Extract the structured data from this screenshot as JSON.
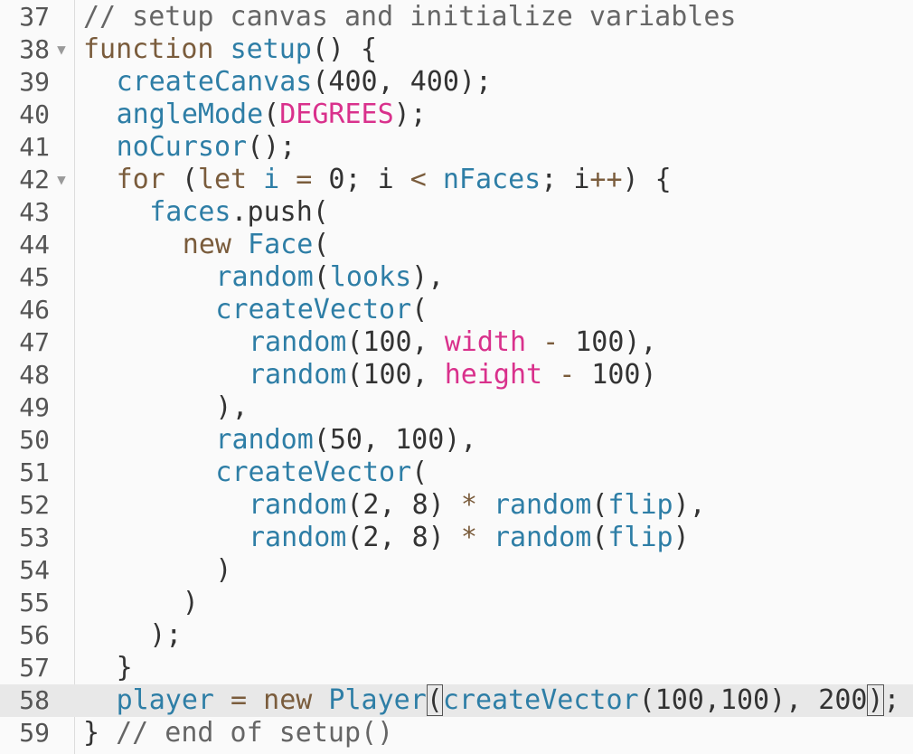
{
  "editor": {
    "lines": [
      {
        "n": "37",
        "fold": "",
        "indent": 0,
        "tokens": [
          {
            "t": "// setup canvas and initialize variables",
            "c": "comment"
          }
        ]
      },
      {
        "n": "38",
        "fold": "▼",
        "indent": 0,
        "tokens": [
          {
            "t": "function",
            "c": "keyword"
          },
          {
            "t": " ",
            "c": "plain"
          },
          {
            "t": "setup",
            "c": "func"
          },
          {
            "t": "() {",
            "c": "plain"
          }
        ]
      },
      {
        "n": "39",
        "fold": "",
        "indent": 1,
        "tokens": [
          {
            "t": "createCanvas",
            "c": "func"
          },
          {
            "t": "(400, 400);",
            "c": "plain"
          }
        ]
      },
      {
        "n": "40",
        "fold": "",
        "indent": 1,
        "tokens": [
          {
            "t": "angleMode",
            "c": "func"
          },
          {
            "t": "(",
            "c": "plain"
          },
          {
            "t": "DEGREES",
            "c": "constant"
          },
          {
            "t": ");",
            "c": "plain"
          }
        ]
      },
      {
        "n": "41",
        "fold": "",
        "indent": 1,
        "tokens": [
          {
            "t": "noCursor",
            "c": "func"
          },
          {
            "t": "();",
            "c": "plain"
          }
        ]
      },
      {
        "n": "42",
        "fold": "▼",
        "indent": 1,
        "tokens": [
          {
            "t": "for",
            "c": "keyword"
          },
          {
            "t": " (",
            "c": "plain"
          },
          {
            "t": "let",
            "c": "keyword"
          },
          {
            "t": " ",
            "c": "plain"
          },
          {
            "t": "i",
            "c": "var"
          },
          {
            "t": " ",
            "c": "plain"
          },
          {
            "t": "=",
            "c": "operator"
          },
          {
            "t": " 0; i ",
            "c": "plain"
          },
          {
            "t": "<",
            "c": "operator"
          },
          {
            "t": " ",
            "c": "plain"
          },
          {
            "t": "nFaces",
            "c": "var"
          },
          {
            "t": "; i",
            "c": "plain"
          },
          {
            "t": "++",
            "c": "operator"
          },
          {
            "t": ") {",
            "c": "plain"
          }
        ]
      },
      {
        "n": "43",
        "fold": "",
        "indent": 2,
        "tokens": [
          {
            "t": "faces",
            "c": "var"
          },
          {
            "t": ".push(",
            "c": "plain"
          }
        ]
      },
      {
        "n": "44",
        "fold": "",
        "indent": 3,
        "tokens": [
          {
            "t": "new",
            "c": "keyword"
          },
          {
            "t": " ",
            "c": "plain"
          },
          {
            "t": "Face",
            "c": "var"
          },
          {
            "t": "(",
            "c": "plain"
          }
        ]
      },
      {
        "n": "45",
        "fold": "",
        "indent": 4,
        "tokens": [
          {
            "t": "random",
            "c": "func"
          },
          {
            "t": "(",
            "c": "plain"
          },
          {
            "t": "looks",
            "c": "var"
          },
          {
            "t": "),",
            "c": "plain"
          }
        ]
      },
      {
        "n": "46",
        "fold": "",
        "indent": 4,
        "tokens": [
          {
            "t": "createVector",
            "c": "func"
          },
          {
            "t": "(",
            "c": "plain"
          }
        ]
      },
      {
        "n": "47",
        "fold": "",
        "indent": 5,
        "tokens": [
          {
            "t": "random",
            "c": "func"
          },
          {
            "t": "(100, ",
            "c": "plain"
          },
          {
            "t": "width",
            "c": "constant"
          },
          {
            "t": " ",
            "c": "plain"
          },
          {
            "t": "-",
            "c": "operator"
          },
          {
            "t": " 100),",
            "c": "plain"
          }
        ]
      },
      {
        "n": "48",
        "fold": "",
        "indent": 5,
        "tokens": [
          {
            "t": "random",
            "c": "func"
          },
          {
            "t": "(100, ",
            "c": "plain"
          },
          {
            "t": "height",
            "c": "constant"
          },
          {
            "t": " ",
            "c": "plain"
          },
          {
            "t": "-",
            "c": "operator"
          },
          {
            "t": " 100)",
            "c": "plain"
          }
        ]
      },
      {
        "n": "49",
        "fold": "",
        "indent": 4,
        "tokens": [
          {
            "t": "),",
            "c": "plain"
          }
        ]
      },
      {
        "n": "50",
        "fold": "",
        "indent": 4,
        "tokens": [
          {
            "t": "random",
            "c": "func"
          },
          {
            "t": "(50, 100),",
            "c": "plain"
          }
        ]
      },
      {
        "n": "51",
        "fold": "",
        "indent": 4,
        "tokens": [
          {
            "t": "createVector",
            "c": "func"
          },
          {
            "t": "(",
            "c": "plain"
          }
        ]
      },
      {
        "n": "52",
        "fold": "",
        "indent": 5,
        "tokens": [
          {
            "t": "random",
            "c": "func"
          },
          {
            "t": "(2, 8) ",
            "c": "plain"
          },
          {
            "t": "*",
            "c": "operator"
          },
          {
            "t": " ",
            "c": "plain"
          },
          {
            "t": "random",
            "c": "func"
          },
          {
            "t": "(",
            "c": "plain"
          },
          {
            "t": "flip",
            "c": "var"
          },
          {
            "t": "),",
            "c": "plain"
          }
        ]
      },
      {
        "n": "53",
        "fold": "",
        "indent": 5,
        "tokens": [
          {
            "t": "random",
            "c": "func"
          },
          {
            "t": "(2, 8) ",
            "c": "plain"
          },
          {
            "t": "*",
            "c": "operator"
          },
          {
            "t": " ",
            "c": "plain"
          },
          {
            "t": "random",
            "c": "func"
          },
          {
            "t": "(",
            "c": "plain"
          },
          {
            "t": "flip",
            "c": "var"
          },
          {
            "t": ")",
            "c": "plain"
          }
        ]
      },
      {
        "n": "54",
        "fold": "",
        "indent": 4,
        "tokens": [
          {
            "t": ")",
            "c": "plain"
          }
        ]
      },
      {
        "n": "55",
        "fold": "",
        "indent": 3,
        "tokens": [
          {
            "t": ")",
            "c": "plain"
          }
        ]
      },
      {
        "n": "56",
        "fold": "",
        "indent": 2,
        "tokens": [
          {
            "t": ");",
            "c": "plain"
          }
        ]
      },
      {
        "n": "57",
        "fold": "",
        "indent": 1,
        "tokens": [
          {
            "t": "}",
            "c": "plain"
          }
        ]
      },
      {
        "n": "58",
        "fold": "",
        "indent": 1,
        "active": true,
        "tokens": [
          {
            "t": "player",
            "c": "var"
          },
          {
            "t": " ",
            "c": "plain"
          },
          {
            "t": "=",
            "c": "operator"
          },
          {
            "t": " ",
            "c": "plain"
          },
          {
            "t": "new",
            "c": "keyword"
          },
          {
            "t": " ",
            "c": "plain"
          },
          {
            "t": "Player",
            "c": "var"
          },
          {
            "t": "(",
            "c": "plain",
            "bracket_match": true
          },
          {
            "t": "createVector",
            "c": "func"
          },
          {
            "t": "(100,100), 20",
            "c": "plain"
          },
          {
            "t": "0",
            "c": "plain"
          },
          {
            "t": ")",
            "c": "plain",
            "bracket_match": true
          },
          {
            "t": ";",
            "c": "plain"
          }
        ]
      },
      {
        "n": "59",
        "fold": "",
        "indent": 0,
        "tokens": [
          {
            "t": "} ",
            "c": "plain"
          },
          {
            "t": "// end of setup()",
            "c": "comment"
          }
        ]
      }
    ]
  },
  "colors": {
    "comment": "#666666",
    "keyword": "#7a5c3c",
    "func": "#2e7ea6",
    "var": "#2e7ea6",
    "constant": "#d9318c",
    "operator": "#7a5c3c",
    "plain": "#333333",
    "active_line_bg": "#e8e8e8",
    "background": "#fafafa"
  }
}
